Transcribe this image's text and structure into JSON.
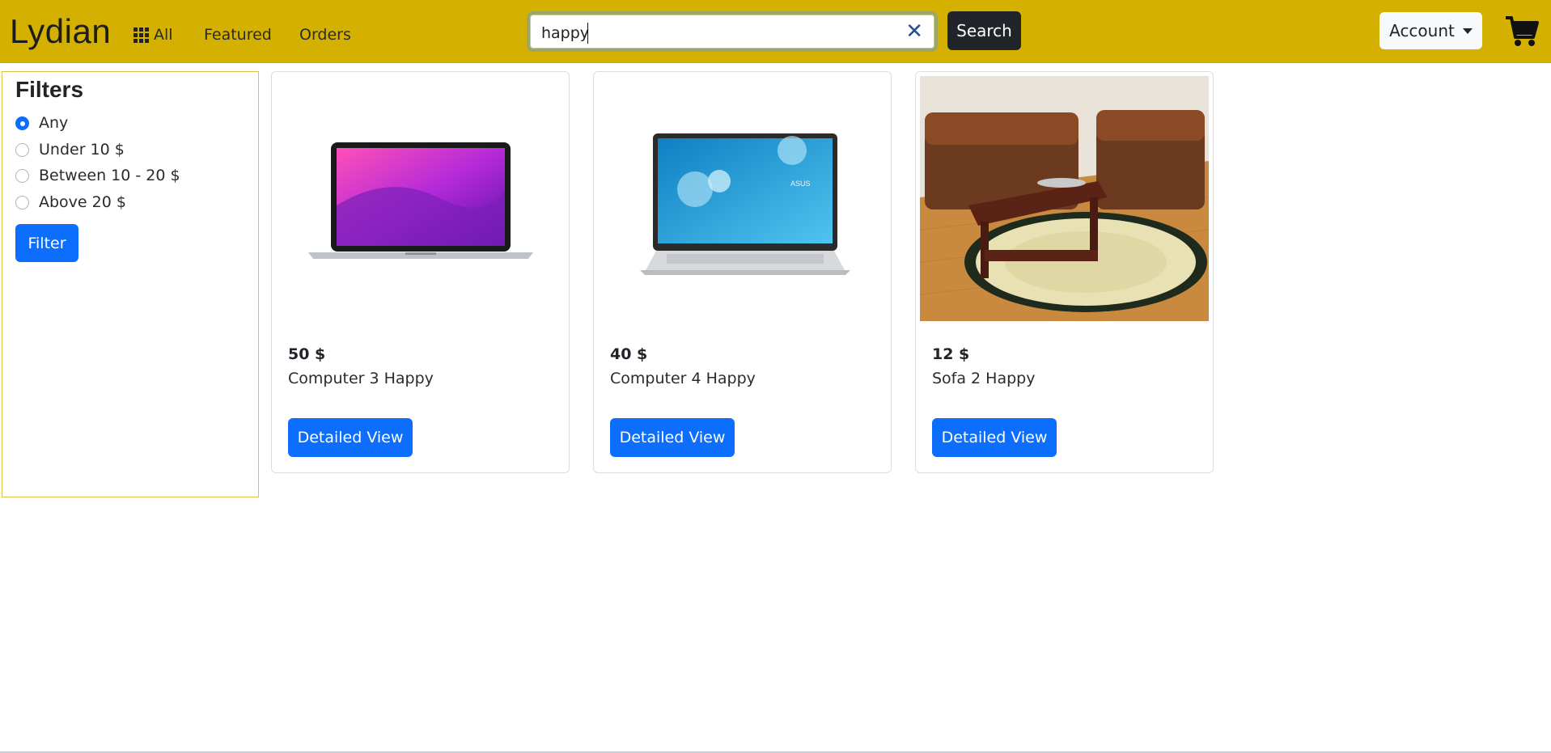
{
  "brand": {
    "name": "Lydian"
  },
  "nav": {
    "all_label": "All",
    "featured_label": "Featured",
    "orders_label": "Orders"
  },
  "search": {
    "value": "happy",
    "button_label": "Search"
  },
  "account": {
    "label": "Account"
  },
  "filters": {
    "title": "Filters",
    "options": [
      "Any",
      "Under 10 $",
      "Between 10 - 20 $",
      "Above 20 $"
    ],
    "selected": "Any",
    "button_label": "Filter"
  },
  "products": [
    {
      "price": "50 $",
      "name": "Computer 3 Happy",
      "button_label": "Detailed View",
      "image": "laptop-macbook"
    },
    {
      "price": "40 $",
      "name": "Computer 4 Happy",
      "button_label": "Detailed View",
      "image": "laptop-asus"
    },
    {
      "price": "12 $",
      "name": "Sofa 2 Happy",
      "button_label": "Detailed View",
      "image": "sofa-set"
    }
  ],
  "colors": {
    "navbar": "#d4b100",
    "primary": "#0d6efd",
    "dark": "#212529"
  }
}
